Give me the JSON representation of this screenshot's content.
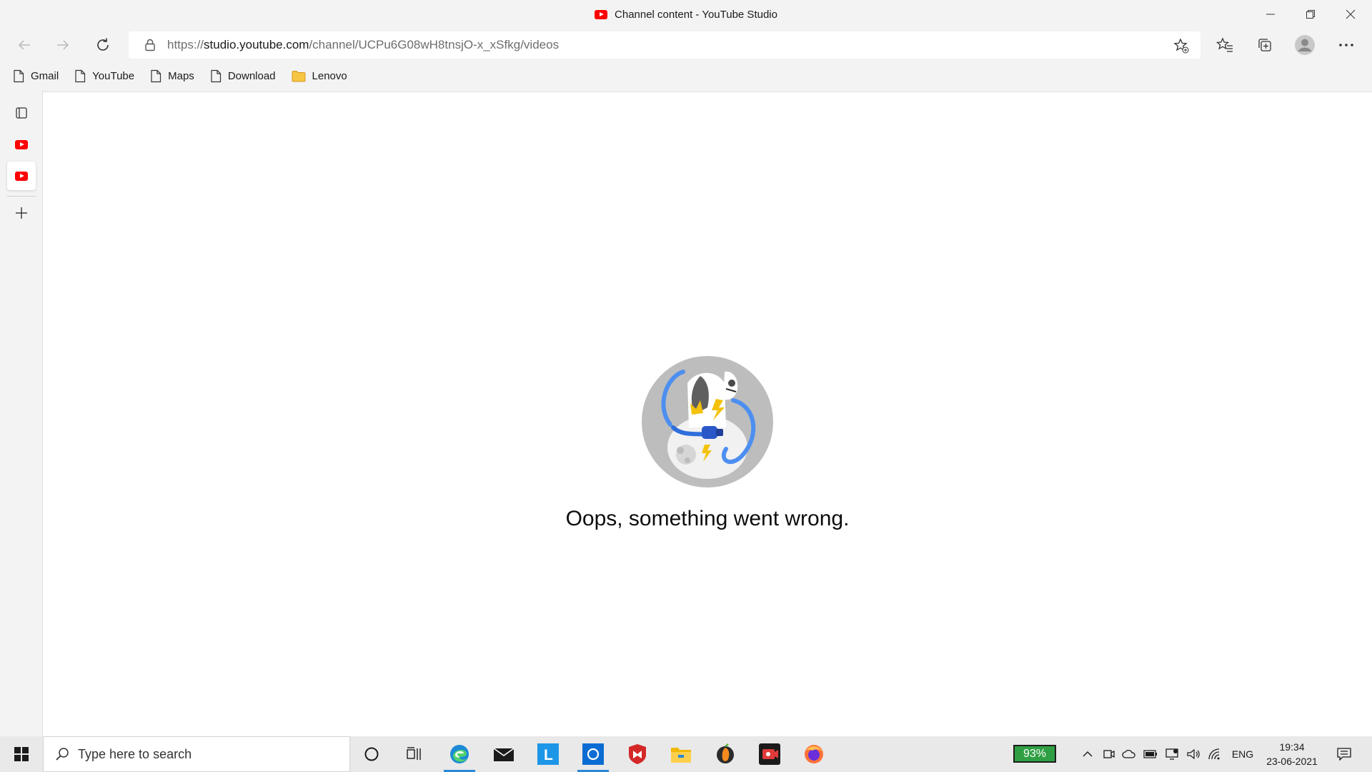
{
  "window": {
    "title": "Channel content - YouTube Studio",
    "controls": [
      "minimize-icon",
      "restore-icon",
      "close-icon"
    ]
  },
  "nav": {
    "url_prefix": "https://",
    "url_domain": "studio.youtube.com",
    "url_path": "/channel/UCPu6G08wH8tnsjO-x_xSfkg/videos"
  },
  "bookmarks": [
    {
      "label": "Gmail",
      "icon": "page-icon"
    },
    {
      "label": "YouTube",
      "icon": "page-icon"
    },
    {
      "label": "Maps",
      "icon": "page-icon"
    },
    {
      "label": "Download",
      "icon": "page-icon"
    },
    {
      "label": "Lenovo",
      "icon": "folder-icon"
    }
  ],
  "content": {
    "error_message": "Oops, something went wrong."
  },
  "taskbar": {
    "search_placeholder": "Type here to search",
    "battery": "93%",
    "language": "ENG",
    "time": "19:34",
    "date": "23-06-2021"
  },
  "colors": {
    "youtube_red": "#ff0000",
    "edge_blue": "#2b88d8",
    "battery_green": "#2ea043"
  }
}
